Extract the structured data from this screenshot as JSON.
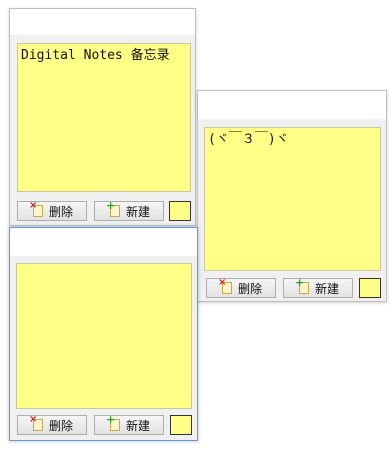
{
  "colors": {
    "note_yellow": "#ffff88",
    "window_bg": "#f0f0f0",
    "active_border": "#6d99c6"
  },
  "notes": [
    {
      "text": "Digital Notes 备忘录",
      "delete_label": "删除",
      "new_label": "新建",
      "color_swatch": "#ffff88",
      "active": false
    },
    {
      "text": "(ヾ￣３￣)ヾ",
      "delete_label": "删除",
      "new_label": "新建",
      "color_swatch": "#ffff88",
      "active": false
    },
    {
      "text": "",
      "delete_label": "删除",
      "new_label": "新建",
      "color_swatch": "#ffff88",
      "active": true
    }
  ],
  "icons": {
    "delete": "delete-note-icon",
    "new": "new-note-icon"
  }
}
